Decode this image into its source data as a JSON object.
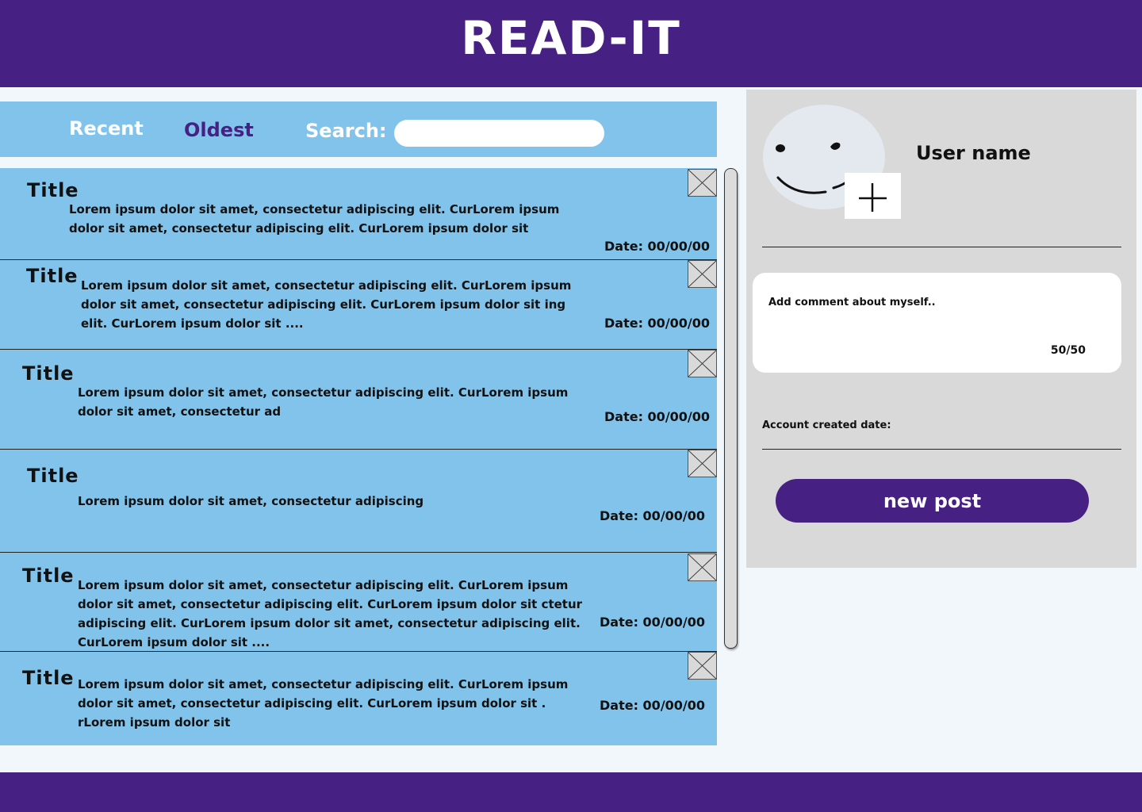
{
  "header": {
    "title": "READ-IT"
  },
  "filter": {
    "recent_label": "Recent",
    "oldest_label": "Oldest",
    "search_label": "Search:",
    "search_value": ""
  },
  "posts": [
    {
      "title": "Title",
      "body": "Lorem ipsum dolor sit amet, consectetur adipiscing elit. CurLorem ipsum dolor sit amet, consectetur adipiscing elit. CurLorem ipsum dolor sit",
      "date": "Date: 00/00/00"
    },
    {
      "title": "Title",
      "body": "Lorem ipsum dolor sit amet, consectetur adipiscing elit. CurLorem ipsum dolor sit amet, consectetur adipiscing elit. CurLorem ipsum dolor sit ing elit. CurLorem ipsum dolor sit ....",
      "date": "Date: 00/00/00"
    },
    {
      "title": "Title",
      "body": "Lorem ipsum dolor sit amet, consectetur adipiscing elit. CurLorem ipsum dolor sit amet, consectetur ad",
      "date": "Date: 00/00/00"
    },
    {
      "title": "Title",
      "body": "Lorem ipsum dolor sit amet, consectetur adipiscing",
      "date": "Date: 00/00/00"
    },
    {
      "title": "Title",
      "body": "Lorem ipsum dolor sit amet, consectetur adipiscing elit. CurLorem ipsum dolor sit amet, consectetur adipiscing elit. CurLorem ipsum dolor sit ctetur adipiscing elit. CurLorem ipsum dolor sit amet, consectetur adipiscing elit. CurLorem ipsum dolor sit ....",
      "date": "Date: 00/00/00"
    },
    {
      "title": "Title",
      "body": "Lorem ipsum dolor sit amet, consectetur adipiscing elit. CurLorem ipsum dolor sit amet, consectetur adipiscing elit. CurLorem ipsum dolor sit . rLorem ipsum dolor sit",
      "date": "Date: 00/00/00"
    }
  ],
  "profile": {
    "username": "User name",
    "comment_placeholder": "Add comment about myself..",
    "comment_count": "50/50",
    "account_created_label": "Account created date:",
    "new_post_label": "new post"
  },
  "colors": {
    "brand": "#472083",
    "post_background": "#82c3ec",
    "panel_background": "#d9d9d9",
    "page_background": "#f1f7fb"
  }
}
